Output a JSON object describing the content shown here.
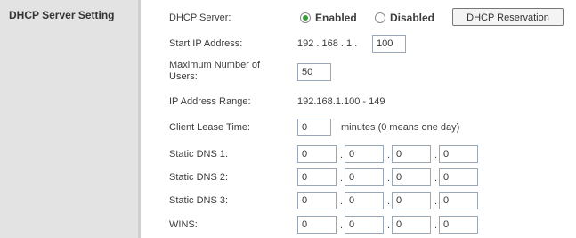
{
  "section_title": "DHCP Server Setting",
  "dhcp_server": {
    "label": "DHCP Server:",
    "enabled_label": "Enabled",
    "disabled_label": "Disabled",
    "selected": "Enabled",
    "reservation_button": "DHCP Reservation"
  },
  "start_ip": {
    "label": "Start IP Address:",
    "prefix": "192 . 168 . 1 .",
    "last_octet": "100"
  },
  "max_users": {
    "label_line1": "Maximum Number of",
    "label_line2": "Users:",
    "value": "50"
  },
  "ip_range": {
    "label": "IP Address Range:",
    "value": "192.168.1.100 - 149"
  },
  "lease_time": {
    "label": "Client Lease Time:",
    "value": "0",
    "hint": "minutes (0 means one day)"
  },
  "static_dns_1": {
    "label": "Static DNS 1:",
    "octets": [
      "0",
      "0",
      "0",
      "0"
    ]
  },
  "static_dns_2": {
    "label": "Static DNS 2:",
    "octets": [
      "0",
      "0",
      "0",
      "0"
    ]
  },
  "static_dns_3": {
    "label": "Static DNS 3:",
    "octets": [
      "0",
      "0",
      "0",
      "0"
    ]
  },
  "wins": {
    "label": "WINS:",
    "octets": [
      "0",
      "0",
      "0",
      "0"
    ]
  }
}
